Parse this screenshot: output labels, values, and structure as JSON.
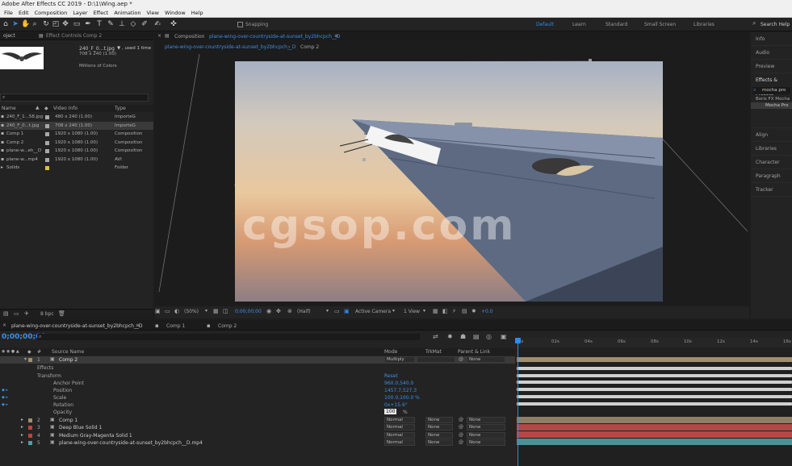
{
  "window": {
    "title": "Adobe After Effects CC 2019 - D:\\1\\Wing.aep *"
  },
  "menu": [
    "File",
    "Edit",
    "Composition",
    "Layer",
    "Effect",
    "Animation",
    "View",
    "Window",
    "Help"
  ],
  "toolbar": {
    "snapping_label": "Snapping",
    "workspaces": [
      "Default",
      "Learn",
      "Standard",
      "Small Screen",
      "Libraries"
    ],
    "active_workspace": "Default",
    "search_placeholder": "Search Help"
  },
  "project_panel": {
    "tab_project": "oject",
    "tab_effect_controls": "Effect Controls  Comp 2",
    "selected_item": {
      "name": "240_F_0...t.jpg",
      "used": "▼ , used 1 time",
      "size": "708 x 240 (1.00)",
      "colors": "Millions of Colors"
    },
    "columns": {
      "name": "Name",
      "video_info": "Video Info",
      "type": "Type"
    },
    "items": [
      {
        "name": "240_F_1...58.jpg",
        "info": "480 x 240 (1.00)",
        "type": "ImporteG",
        "color": "#a8a8a8"
      },
      {
        "name": "240_F_0...t.jpg",
        "info": "708 x 240 (1.00)",
        "type": "ImporteG",
        "color": "#a8a8a8"
      },
      {
        "name": "Comp 1",
        "info": "1920 x 1080 (1.00)",
        "type": "Composition",
        "color": "#a8a8a8"
      },
      {
        "name": "Comp 2",
        "info": "1920 x 1080 (1.00)",
        "type": "Composition",
        "color": "#a8a8a8"
      },
      {
        "name": "plane-w...eh__D",
        "info": "1920 x 1080 (1.00)",
        "type": "Composition",
        "color": "#a8a8a8"
      },
      {
        "name": "plane-w...mp4",
        "info": "1920 x 1080 (1.00)",
        "type": "AVI",
        "color": "#a8a8a8"
      },
      {
        "name": "Solids",
        "info": "",
        "type": "Folder",
        "color": "#e0c040"
      }
    ],
    "bpc": "8 bpc"
  },
  "composition_panel": {
    "tab_label": "Composition",
    "tab_name": "plane-wing-over-countryside-at-sunset_by2bhcpch__D",
    "breadcrumb_1": "plane-wing-over-countryside-at-sunset_by2bhcpch__D",
    "breadcrumb_2": "Comp 2",
    "watermark": "cgsop.com",
    "zoom": "(50%)",
    "timecode": "0;00;00;00",
    "resolution": "(Half)",
    "camera": "Active Camera",
    "views": "1 View",
    "exposure": "+0.0"
  },
  "right_panel": {
    "items": [
      "Info",
      "Audio",
      "Preview",
      "Effects & Presets",
      "Align",
      "Libraries",
      "Character",
      "Paragraph",
      "Tracker"
    ],
    "effects_search": "mocha pro",
    "effects_group": "Boris FX Mocha",
    "effects_item": "Mocha Pro"
  },
  "timeline": {
    "tabs": [
      "plane-wing-over-countryside-at-sunset_by2bhcpch__D",
      "Comp 1",
      "Comp 2"
    ],
    "timecode": "0;00;00;00",
    "columns": {
      "source_name": "Source Name",
      "mode": "Mode",
      "trkmat": "TrkMat",
      "parent": "Parent & Link"
    },
    "ruler": [
      "0s",
      "02s",
      "04s",
      "06s",
      "08s",
      "10s",
      "12s",
      "14s",
      "16s"
    ],
    "layers": [
      {
        "num": "1",
        "name": "Comp 2",
        "mode": "Multiply",
        "trkmat": "",
        "parent": "None",
        "color": "#a08e6e"
      },
      {
        "num": "2",
        "name": "Comp 1",
        "mode": "Normal",
        "trkmat": "None",
        "parent": "None",
        "color": "#a08e6e"
      },
      {
        "num": "3",
        "name": "Deep Blue Solid 1",
        "mode": "Normal",
        "trkmat": "None",
        "parent": "None",
        "color": "#c24040"
      },
      {
        "num": "4",
        "name": "Medium Gray-Magenta Solid 1",
        "mode": "Normal",
        "trkmat": "None",
        "parent": "None",
        "color": "#c24040"
      },
      {
        "num": "5",
        "name": "plane-wing-over-countryside-at-sunset_by2bhcpch__D.mp4",
        "mode": "Normal",
        "trkmat": "None",
        "parent": "None",
        "color": "#4ba0a8"
      }
    ],
    "props": {
      "effects": "Effects",
      "transform": "Transform",
      "reset": "Reset",
      "anchor_point": {
        "label": "Anchor Point",
        "value": "960.0,540.0"
      },
      "position": {
        "label": "Position",
        "value": "1457.7,527.3"
      },
      "scale": {
        "label": "Scale",
        "value": "100.0,100.0 %"
      },
      "rotation": {
        "label": "Rotation",
        "value": "0x+15.6°"
      },
      "opacity": {
        "label": "Opacity",
        "value": "100",
        "unit": "%"
      }
    }
  }
}
